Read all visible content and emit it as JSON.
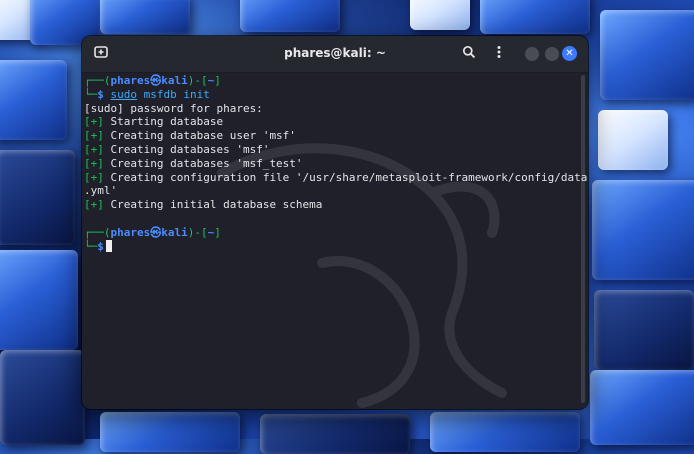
{
  "window": {
    "title": "phares@kali: ~"
  },
  "terminal": {
    "lines": [
      "[sudo] password for phares:",
      "[+] Starting database",
      "[+] Creating database user 'msf'",
      "[+] Creating databases 'msf'",
      "[+] Creating databases 'msf_test'",
      "[+] Creating configuration file '/usr/share/metasploit-framework/config/database",
      ".yml'",
      "[+] Creating initial database schema"
    ],
    "prompt1": {
      "user_host": "phares㉿kali",
      "dir": "~",
      "cmd_sudo": "sudo",
      "cmd_rest": " msfdb init"
    },
    "prompt2": {
      "user_host": "phares㉿kali",
      "dir": "~"
    }
  },
  "icons": [
    "new-tab-icon",
    "search-icon",
    "kebab-menu-icon",
    "minimize-icon",
    "maximize-icon",
    "close-icon",
    "kali-dragon-logo"
  ],
  "colors": {
    "prompt_green": "#19c45a",
    "prompt_blue": "#4a8cff",
    "accent_close": "#3c7bff",
    "terminal_bg": "#1f2029"
  }
}
